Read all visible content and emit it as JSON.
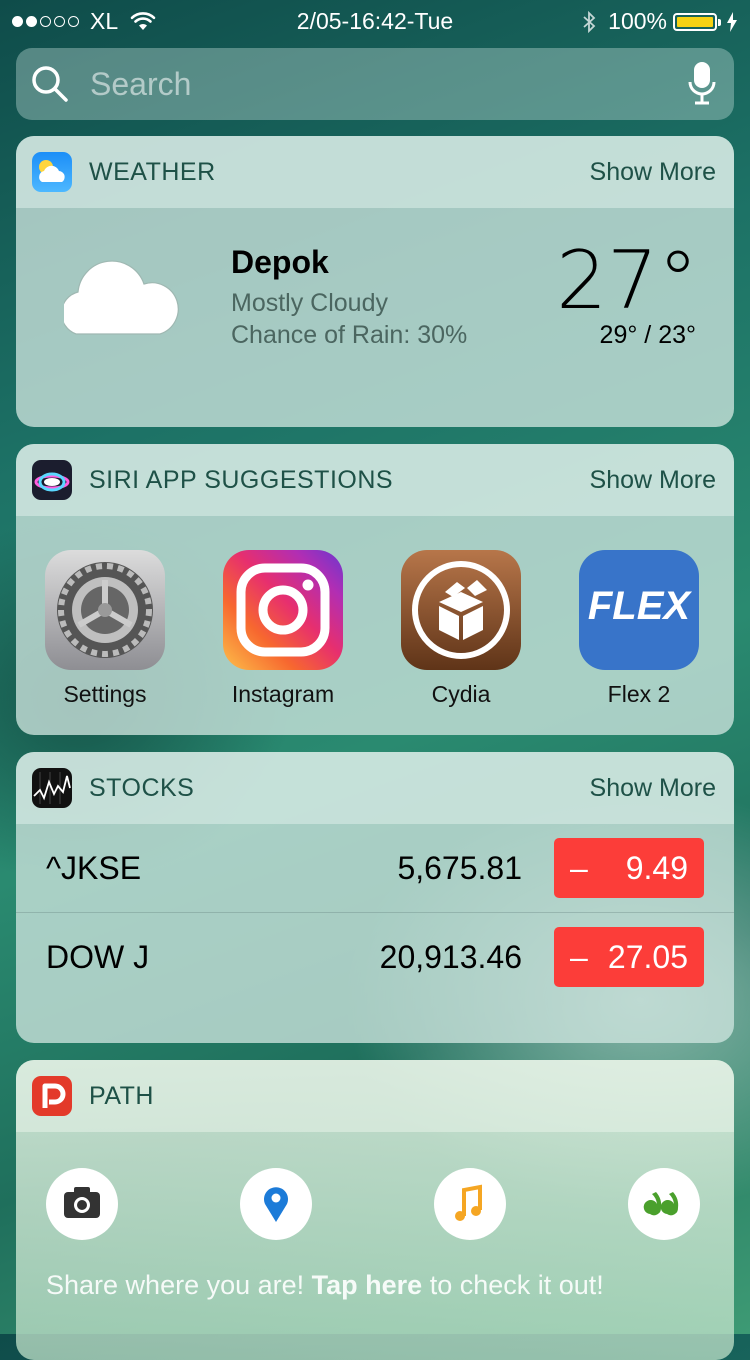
{
  "status_bar": {
    "carrier": "XL",
    "time": "2/05-16:42-Tue",
    "battery": "100%",
    "signal_bars": 2,
    "signal_total": 5
  },
  "search": {
    "placeholder": "Search"
  },
  "weather": {
    "title": "WEATHER",
    "show_more": "Show More",
    "city": "Depok",
    "condition": "Mostly Cloudy",
    "rain": "Chance of Rain: 30%",
    "temp": "27°",
    "range": "29° / 23°"
  },
  "siri": {
    "title": "SIRI APP SUGGESTIONS",
    "show_more": "Show More",
    "apps": [
      {
        "label": "Settings",
        "icon": "settings-gear-icon"
      },
      {
        "label": "Instagram",
        "icon": "instagram-camera-icon"
      },
      {
        "label": "Cydia",
        "icon": "cydia-box-icon"
      },
      {
        "label": "Flex 2",
        "icon": "flex-icon",
        "icon_text": "FLEX"
      }
    ]
  },
  "stocks": {
    "title": "STOCKS",
    "show_more": "Show More",
    "rows": [
      {
        "name": "^JKSE",
        "price": "5,675.81",
        "change": "9.49",
        "sign": "–"
      },
      {
        "name": "DOW J",
        "price": "20,913.46",
        "change": "27.05",
        "sign": "–"
      }
    ],
    "negative_color": "#fc3d39"
  },
  "path": {
    "title": "PATH",
    "actions": [
      "camera-icon",
      "location-pin-icon",
      "music-note-icon",
      "quote-icon"
    ],
    "share_prefix": "Share where you are! ",
    "share_bold": "Tap here",
    "share_suffix": " to check it out!"
  }
}
